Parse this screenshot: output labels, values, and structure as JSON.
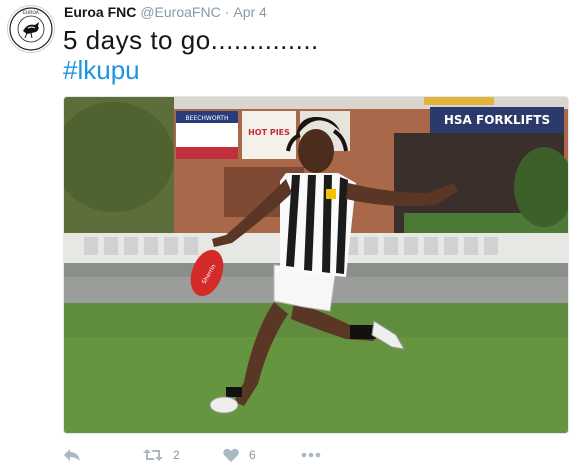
{
  "user": {
    "display_name": "Euroa FNC",
    "handle": "@EuroaFNC",
    "separator": "·",
    "date": "Apr 4",
    "avatar_icon": "magpie-club-logo",
    "avatar_text": "EUROA FOOTBALL NETBALL CLUB"
  },
  "tweet": {
    "line1": "5 days to go..............",
    "hashtag": "#lkupu"
  },
  "media": {
    "banner_left": "BEECHWORTH",
    "pies_sign": "HOT PIES",
    "banner_right": "HSA FORKLIFTS",
    "ball_brand": "Sherrin"
  },
  "actions": {
    "reply_icon": "reply-icon",
    "retweet_icon": "retweet-icon",
    "retweet_count": "2",
    "like_icon": "heart-icon",
    "like_count": "6",
    "more_icon": "more-icon"
  },
  "colors": {
    "hashtag": "#1b95e0",
    "action_icon": "#aab8c2",
    "meta": "#8899a6"
  }
}
